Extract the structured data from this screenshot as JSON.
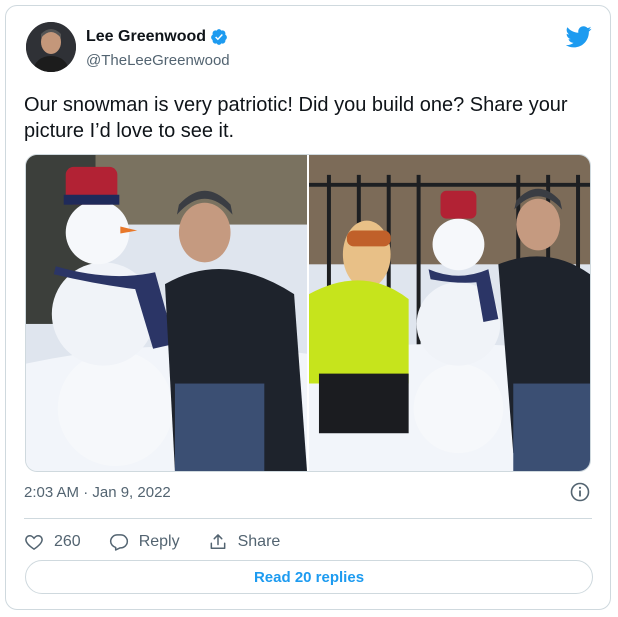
{
  "author": {
    "display_name": "Lee Greenwood",
    "handle": "@TheLeeGreenwood",
    "verified": true,
    "avatar_icon": "profile-avatar"
  },
  "tweet": {
    "text": "Our snowman is very patriotic!  Did you build one?  Share your picture I’d love to see it.",
    "timestamp": "2:03 AM · Jan 9, 2022"
  },
  "media": {
    "count": 2
  },
  "actions": {
    "like_count": "260",
    "reply_label": "Reply",
    "share_label": "Share"
  },
  "footer": {
    "read_replies_label": "Read 20 replies"
  },
  "colors": {
    "accent": "#1d9bf0",
    "text_primary": "#0f1419",
    "text_secondary": "#536471",
    "border": "#cfd9de"
  }
}
